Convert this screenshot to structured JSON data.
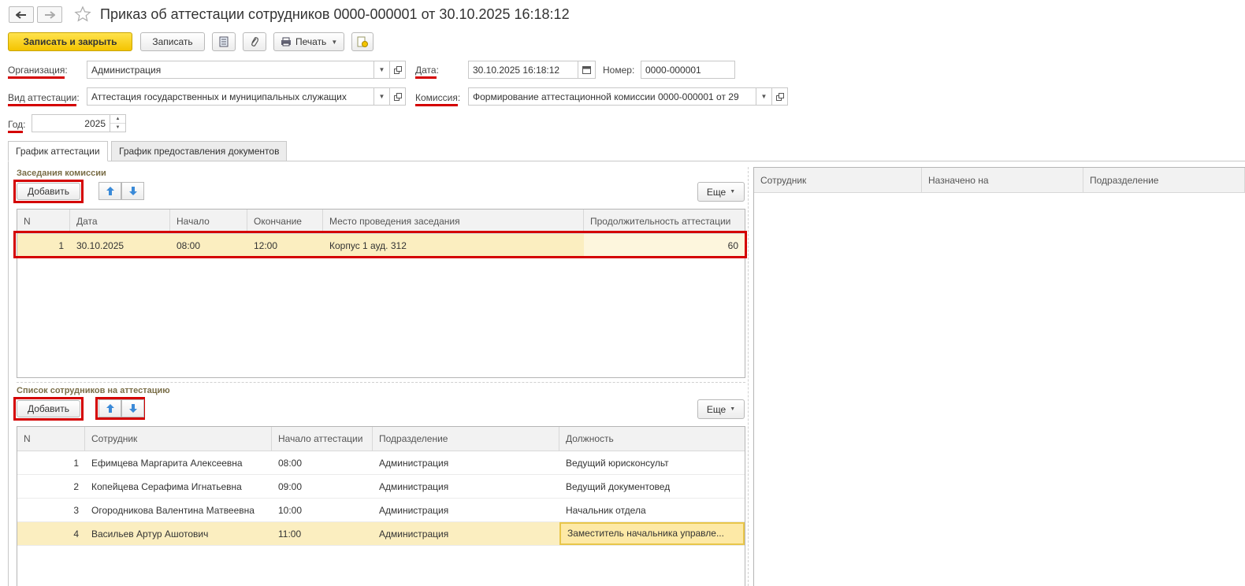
{
  "header": {
    "title": "Приказ об аттестации сотрудников 0000-000001 от 30.10.2025 16:18:12"
  },
  "toolbar": {
    "save_close": "Записать и закрыть",
    "save": "Записать",
    "print": "Печать"
  },
  "form": {
    "org_label": "Организация",
    "org_value": "Администрация",
    "date_label": "Дата",
    "date_value": "30.10.2025 16:18:12",
    "number_label": "Номер:",
    "number_value": "0000-000001",
    "type_label": "Вид аттестации",
    "type_value": "Аттестация государственных и муниципальных служащих",
    "commission_label": "Комиссия",
    "commission_value": "Формирование аттестационной комиссии 0000-000001 от 29",
    "year_label": "Год",
    "year_value": "2025",
    "colon": ":"
  },
  "tabs": [
    {
      "label": "График аттестации",
      "active": true
    },
    {
      "label": "График предоставления документов",
      "active": false
    }
  ],
  "sessions": {
    "title": "Заседания комиссии",
    "add": "Добавить",
    "more": "Еще",
    "columns": [
      "N",
      "Дата",
      "Начало",
      "Окончание",
      "Место проведения заседания",
      "Продолжительность аттестации"
    ],
    "rows": [
      {
        "n": "1",
        "date": "30.10.2025",
        "start": "08:00",
        "end": "12:00",
        "place": "Корпус 1 ауд. 312",
        "duration": "60"
      }
    ]
  },
  "employees": {
    "title": "Список сотрудников на аттестацию",
    "add": "Добавить",
    "more": "Еще",
    "columns": [
      "N",
      "Сотрудник",
      "Начало аттестации",
      "Подразделение",
      "Должность"
    ],
    "rows": [
      {
        "n": "1",
        "name": "Ефимцева Маргарита Алексеевна",
        "start": "08:00",
        "dept": "Администрация",
        "position": "Ведущий юрисконсульт"
      },
      {
        "n": "2",
        "name": "Копейцева Серафима Игнатьевна",
        "start": "09:00",
        "dept": "Администрация",
        "position": "Ведущий документовед"
      },
      {
        "n": "3",
        "name": "Огородникова Валентина Матвеевна",
        "start": "10:00",
        "dept": "Администрация",
        "position": "Начальник отдела"
      },
      {
        "n": "4",
        "name": "Васильев Артур Ашотович",
        "start": "11:00",
        "dept": "Администрация",
        "position": "Заместитель начальника управле..."
      }
    ]
  },
  "right_panel": {
    "columns": [
      "Сотрудник",
      "Назначено на",
      "Подразделение"
    ]
  },
  "colors": {
    "accent_yellow": "#f4c400",
    "selection": "#fbeec0",
    "highlight_red": "#d40000"
  }
}
